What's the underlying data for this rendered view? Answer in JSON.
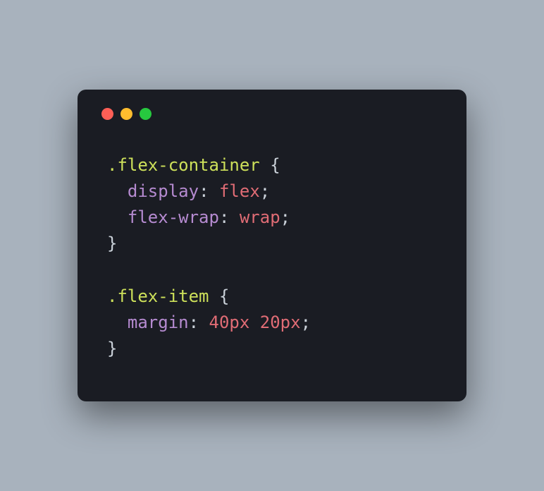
{
  "code": {
    "rule1": {
      "selector": ".flex-container",
      "decls": [
        {
          "prop": "display",
          "val": "flex"
        },
        {
          "prop": "flex-wrap",
          "val": "wrap"
        }
      ]
    },
    "rule2": {
      "selector": ".flex-item",
      "decls": [
        {
          "prop": "margin",
          "val": "40px 20px"
        }
      ]
    }
  },
  "punct": {
    "space": " ",
    "obrace": "{",
    "cbrace": "}",
    "colon": ":",
    "semi": ";",
    "indent": "  "
  }
}
